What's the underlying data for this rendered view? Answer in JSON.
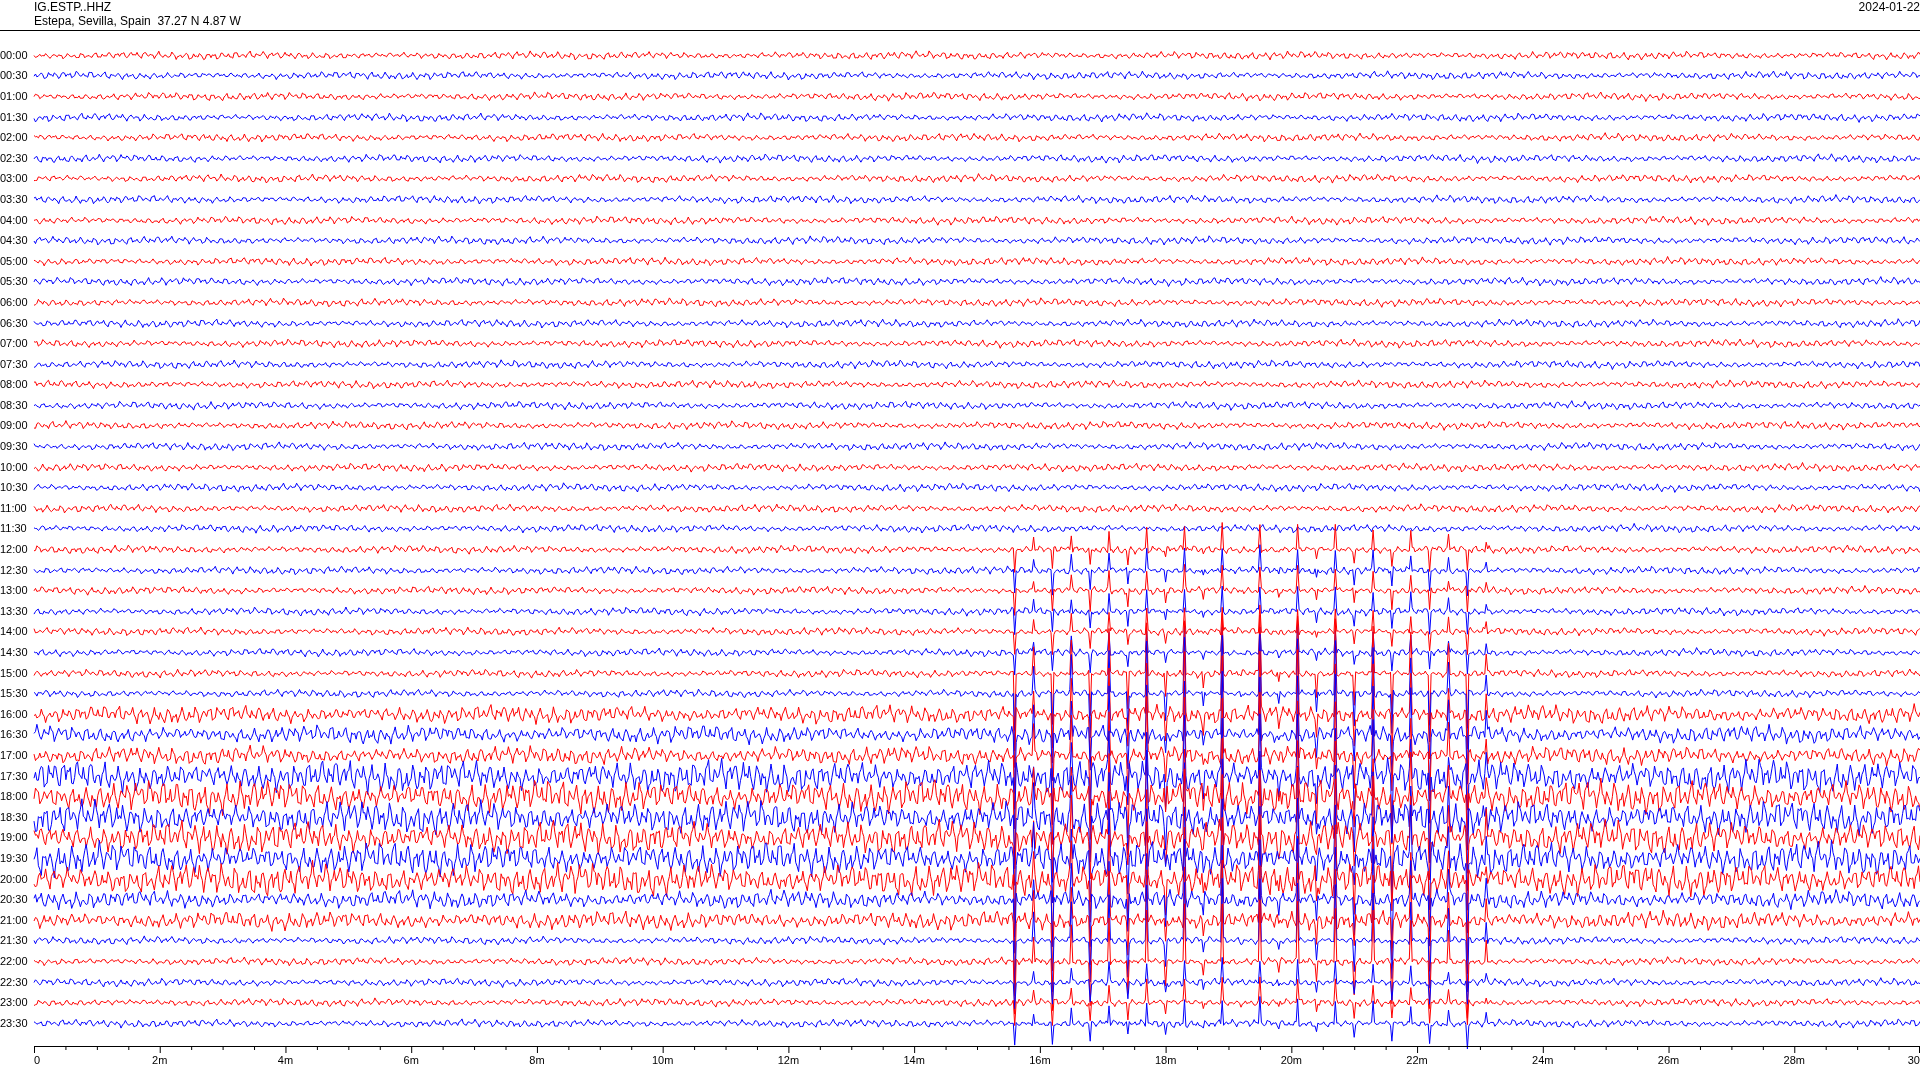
{
  "header": {
    "station": "IG.ESTP..HHZ",
    "location": "Estepa, Sevilla, Spain  37.27 N 4.87 W",
    "date": "2024-01-22"
  },
  "traces": [
    {
      "time": "00:00",
      "color": "#ff0000"
    },
    {
      "time": "00:30",
      "color": "#0000ff"
    },
    {
      "time": "01:00",
      "color": "#ff0000"
    },
    {
      "time": "01:30",
      "color": "#0000ff"
    },
    {
      "time": "02:00",
      "color": "#ff0000"
    },
    {
      "time": "02:30",
      "color": "#0000ff"
    },
    {
      "time": "03:00",
      "color": "#ff0000"
    },
    {
      "time": "03:30",
      "color": "#0000ff"
    },
    {
      "time": "04:00",
      "color": "#ff0000"
    },
    {
      "time": "04:30",
      "color": "#0000ff"
    },
    {
      "time": "05:00",
      "color": "#ff0000"
    },
    {
      "time": "05:30",
      "color": "#0000ff"
    },
    {
      "time": "06:00",
      "color": "#ff0000"
    },
    {
      "time": "06:30",
      "color": "#0000ff"
    },
    {
      "time": "07:00",
      "color": "#ff0000"
    },
    {
      "time": "07:30",
      "color": "#0000ff"
    },
    {
      "time": "08:00",
      "color": "#ff0000"
    },
    {
      "time": "08:30",
      "color": "#0000ff"
    },
    {
      "time": "09:00",
      "color": "#ff0000"
    },
    {
      "time": "09:30",
      "color": "#0000ff"
    },
    {
      "time": "10:00",
      "color": "#ff0000"
    },
    {
      "time": "10:30",
      "color": "#0000ff"
    },
    {
      "time": "11:00",
      "color": "#ff0000"
    },
    {
      "time": "11:30",
      "color": "#0000ff"
    },
    {
      "time": "12:00",
      "color": "#ff0000"
    },
    {
      "time": "12:30",
      "color": "#0000ff"
    },
    {
      "time": "13:00",
      "color": "#ff0000"
    },
    {
      "time": "13:30",
      "color": "#0000ff"
    },
    {
      "time": "14:00",
      "color": "#ff0000"
    },
    {
      "time": "14:30",
      "color": "#0000ff"
    },
    {
      "time": "15:00",
      "color": "#ff0000"
    },
    {
      "time": "15:30",
      "color": "#0000ff"
    },
    {
      "time": "16:00",
      "color": "#ff0000"
    },
    {
      "time": "16:30",
      "color": "#0000ff"
    },
    {
      "time": "17:00",
      "color": "#ff0000"
    },
    {
      "time": "17:30",
      "color": "#0000ff"
    },
    {
      "time": "18:00",
      "color": "#ff0000"
    },
    {
      "time": "18:30",
      "color": "#0000ff"
    },
    {
      "time": "19:00",
      "color": "#ff0000"
    },
    {
      "time": "19:30",
      "color": "#0000ff"
    },
    {
      "time": "20:00",
      "color": "#ff0000"
    },
    {
      "time": "20:30",
      "color": "#0000ff"
    },
    {
      "time": "21:00",
      "color": "#ff0000"
    },
    {
      "time": "21:30",
      "color": "#0000ff"
    },
    {
      "time": "22:00",
      "color": "#ff0000"
    },
    {
      "time": "22:30",
      "color": "#0000ff"
    },
    {
      "time": "23:00",
      "color": "#ff0000"
    },
    {
      "time": "23:30",
      "color": "#0000ff"
    }
  ],
  "x_axis": {
    "ticks": [
      "0",
      "2m",
      "4m",
      "6m",
      "8m",
      "10m",
      "12m",
      "14m",
      "16m",
      "18m",
      "20m",
      "22m",
      "24m",
      "26m",
      "28m",
      "30"
    ]
  }
}
